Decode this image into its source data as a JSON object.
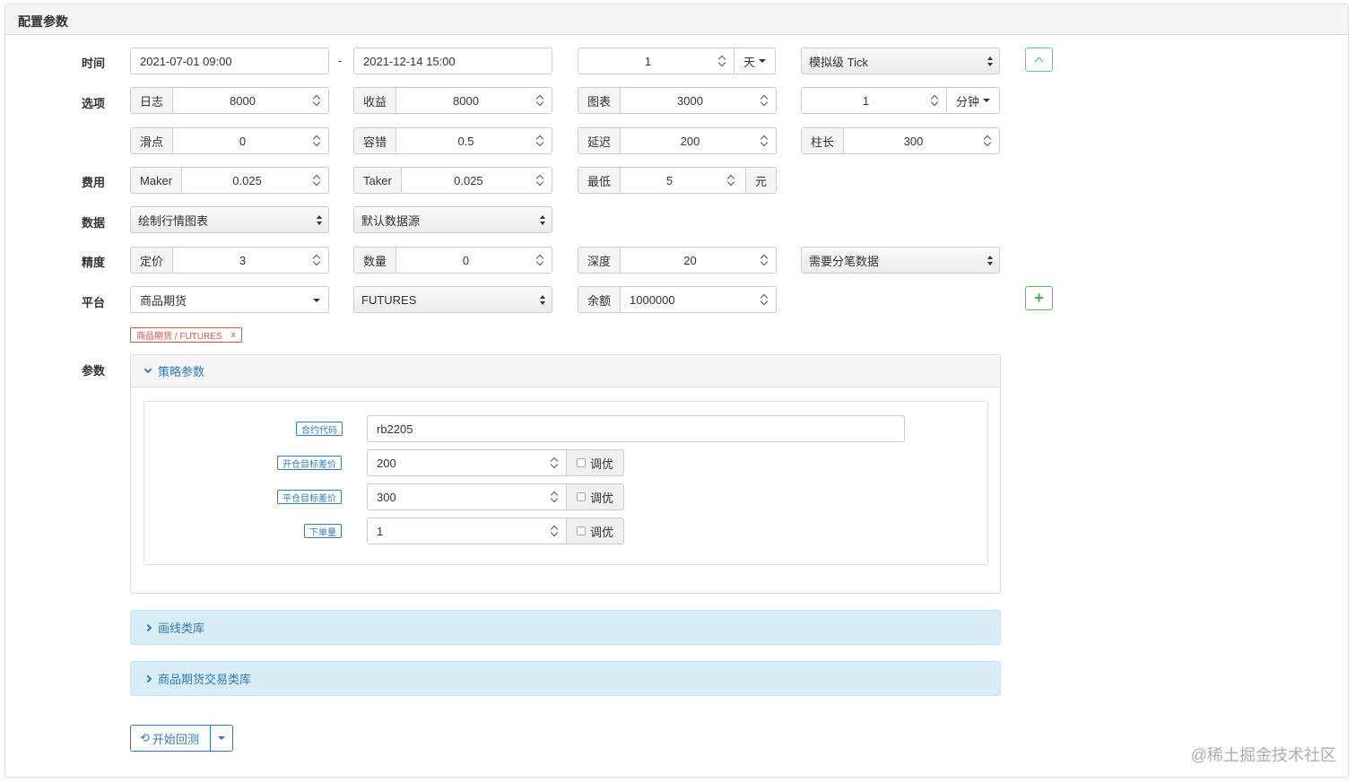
{
  "panel": {
    "title": "配置参数"
  },
  "labels": {
    "time": "时间",
    "options": "选项",
    "fees": "费用",
    "data": "数据",
    "precision": "精度",
    "platform": "平台",
    "params": "参数"
  },
  "time": {
    "start": "2021-07-01 09:00",
    "separator": "-",
    "end": "2021-12-14 15:00",
    "period_value": "1",
    "period_unit": "天",
    "tick_mode": "模拟级 Tick"
  },
  "options": {
    "log_label": "日志",
    "log_value": "8000",
    "profit_label": "收益",
    "profit_value": "8000",
    "chart_label": "图表",
    "chart_value": "3000",
    "kline_value": "1",
    "kline_unit": "分钟",
    "slippage_label": "滑点",
    "slippage_value": "0",
    "tolerance_label": "容错",
    "tolerance_value": "0.5",
    "delay_label": "延迟",
    "delay_value": "200",
    "bar_label": "柱长",
    "bar_value": "300"
  },
  "fees": {
    "maker_label": "Maker",
    "maker_value": "0.025",
    "taker_label": "Taker",
    "taker_value": "0.025",
    "min_label": "最低",
    "min_value": "5",
    "min_unit": "元"
  },
  "data": {
    "chart_select": "绘制行情图表",
    "source_select": "默认数据源"
  },
  "precision": {
    "price_label": "定价",
    "price_value": "3",
    "qty_label": "数量",
    "qty_value": "0",
    "depth_label": "深度",
    "depth_value": "20",
    "trades_select": "需要分笔数据"
  },
  "platform": {
    "exchange_select": "商品期货",
    "market_select": "FUTURES",
    "balance_label": "余额",
    "balance_value": "1000000",
    "tag_text": "商品期货 / FUTURES",
    "tag_close": "x"
  },
  "strategy": {
    "header": "策略参数",
    "tune_label": "调优",
    "fields": [
      {
        "label": "合约代码",
        "value": "rb2205"
      },
      {
        "label": "开仓目标差价",
        "value": "200"
      },
      {
        "label": "平仓目标差价",
        "value": "300"
      },
      {
        "label": "下单量",
        "value": "1"
      }
    ]
  },
  "libraries": [
    {
      "title": "画线类库"
    },
    {
      "title": "商品期货交易类库"
    }
  ],
  "actions": {
    "run": "开始回测",
    "run_icon": "reset-icon"
  },
  "watermark": "@稀土掘金技术社区",
  "colors": {
    "primary": "#337ab7",
    "info_bg": "#d9edf7",
    "danger": "#d9534f",
    "success": "#5cb85c"
  }
}
